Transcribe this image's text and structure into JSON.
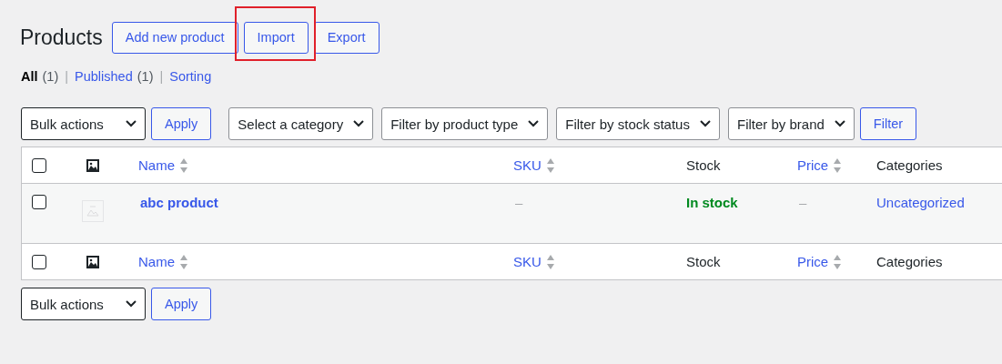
{
  "page": {
    "title": "Products"
  },
  "header_buttons": [
    {
      "label": "Add new product",
      "highlighted": false
    },
    {
      "label": "Import",
      "highlighted": true
    },
    {
      "label": "Export",
      "highlighted": false
    }
  ],
  "views": [
    {
      "label": "All",
      "count": "(1)",
      "selected": true
    },
    {
      "separator": "|",
      "label": "Published",
      "count": "(1)",
      "selected": false
    },
    {
      "separator": "|",
      "label": "Sorting",
      "selected": false
    }
  ],
  "top_bar": {
    "bulk_select": "Bulk actions",
    "apply": "Apply",
    "filters": [
      "Select a category",
      "Filter by product type",
      "Filter by stock status",
      "Filter by brand"
    ],
    "filter_button": "Filter"
  },
  "table": {
    "columns": [
      {
        "kind": "checkbox",
        "checked": false
      },
      {
        "kind": "image"
      },
      {
        "kind": "text",
        "label": "Name",
        "sortable": true
      },
      {
        "kind": "text",
        "label": "SKU",
        "sortable": true
      },
      {
        "kind": "text",
        "label": "Stock",
        "sortable": false
      },
      {
        "kind": "text",
        "label": "Price",
        "sortable": true
      },
      {
        "kind": "text",
        "label": "Categories",
        "sortable": false
      }
    ],
    "rows": [
      {
        "checked": false,
        "name": "abc product",
        "sku": "–",
        "stock": "In stock",
        "color": "#008a20",
        "price": "–",
        "categories": "Uncategorized"
      }
    ],
    "footer_columns": [
      {
        "kind": "checkbox",
        "checked": false
      },
      {
        "kind": "image"
      },
      {
        "kind": "text",
        "label": "Name",
        "sortable": true
      },
      {
        "kind": "text",
        "label": "SKU",
        "sortable": true
      },
      {
        "kind": "text",
        "label": "Stock",
        "sortable": false
      },
      {
        "kind": "text",
        "label": "Price",
        "sortable": true
      },
      {
        "kind": "text",
        "label": "Categories",
        "sortable": false
      }
    ]
  },
  "bottom_bar": {
    "bulk_select": "Bulk actions",
    "apply": "Apply"
  }
}
